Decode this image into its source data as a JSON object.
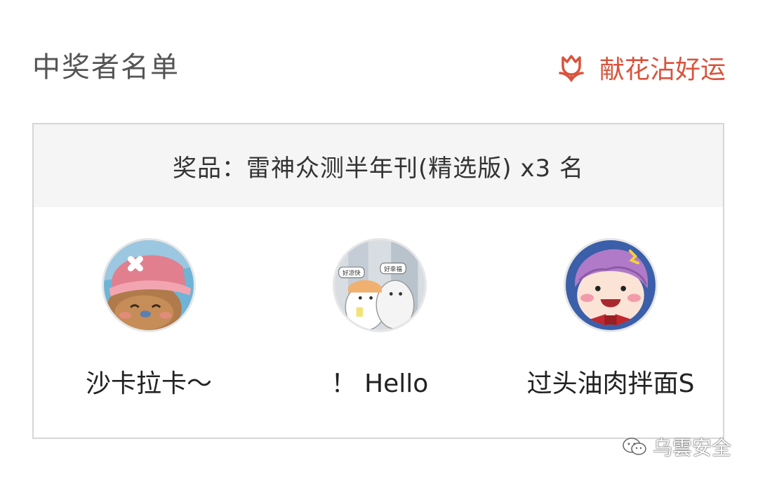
{
  "header": {
    "title": "中奖者名单",
    "flower_label": "献花沾好运"
  },
  "prize": {
    "text": "奖品：雷神众测半年刊(精选版) x3 名"
  },
  "winners": [
    {
      "name": "沙卡拉卡～",
      "avatar_icon": "chopper-avatar"
    },
    {
      "name": "！ Hello",
      "avatar_icon": "cat-couple-avatar"
    },
    {
      "name": "过头油肉拌面S",
      "avatar_icon": "shouting-girl-avatar"
    }
  ],
  "avatar_texts": {
    "left_bubble": "好凉快",
    "right_bubble": "好幸福"
  },
  "watermark": {
    "text": "乌雲安全"
  },
  "colors": {
    "accent": "#d9533c",
    "title_gray": "#555555",
    "prize_bg": "#f5f5f5",
    "border": "#d6d6d6"
  }
}
